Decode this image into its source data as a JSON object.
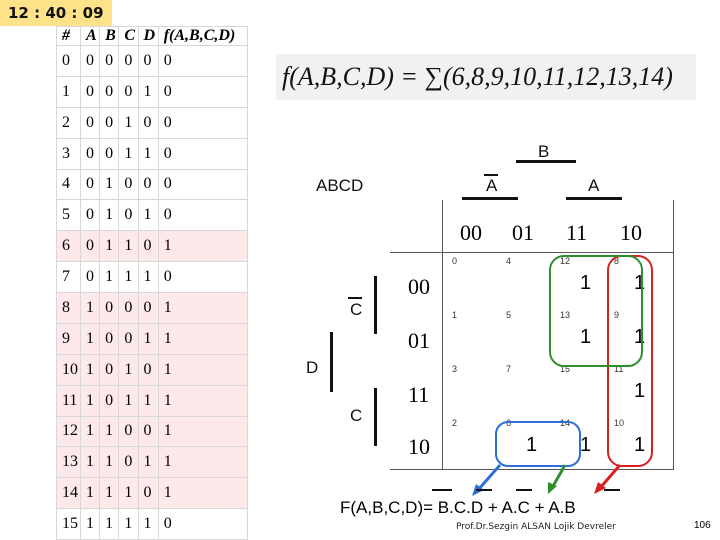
{
  "timer": "12 : 40 : 09",
  "truth_table": {
    "headers": [
      "#",
      "A",
      "B",
      "C",
      "D",
      "f(A,B,C,D)"
    ],
    "rows": [
      [
        "0",
        "0",
        "0",
        "0",
        "0",
        "0"
      ],
      [
        "1",
        "0",
        "0",
        "0",
        "1",
        "0"
      ],
      [
        "2",
        "0",
        "0",
        "1",
        "0",
        "0"
      ],
      [
        "3",
        "0",
        "0",
        "1",
        "1",
        "0"
      ],
      [
        "4",
        "0",
        "1",
        "0",
        "0",
        "0"
      ],
      [
        "5",
        "0",
        "1",
        "0",
        "1",
        "0"
      ],
      [
        "6",
        "0",
        "1",
        "1",
        "0",
        "1"
      ],
      [
        "7",
        "0",
        "1",
        "1",
        "1",
        "0"
      ],
      [
        "8",
        "1",
        "0",
        "0",
        "0",
        "1"
      ],
      [
        "9",
        "1",
        "0",
        "0",
        "1",
        "1"
      ],
      [
        "10",
        "1",
        "0",
        "1",
        "0",
        "1"
      ],
      [
        "11",
        "1",
        "0",
        "1",
        "1",
        "1"
      ],
      [
        "12",
        "1",
        "1",
        "0",
        "0",
        "1"
      ],
      [
        "13",
        "1",
        "1",
        "0",
        "1",
        "1"
      ],
      [
        "14",
        "1",
        "1",
        "1",
        "0",
        "1"
      ],
      [
        "15",
        "1",
        "1",
        "1",
        "1",
        "0"
      ]
    ]
  },
  "formula": "f(A,B,C,D) = ∑(6,8,9,10,11,12,13,14)",
  "kmap": {
    "corner_label": "ABCD",
    "top_labels": [
      "B",
      "A",
      "A"
    ],
    "col_headers": [
      "00",
      "01",
      "11",
      "10"
    ],
    "row_headers": [
      "00",
      "01",
      "11",
      "10"
    ],
    "cell_numbers": [
      [
        "0",
        "4",
        "12",
        "8"
      ],
      [
        "1",
        "5",
        "13",
        "9"
      ],
      [
        "3",
        "7",
        "15",
        "11"
      ],
      [
        "2",
        "6",
        "14",
        "10"
      ]
    ],
    "ones": [
      [
        "",
        "",
        "1",
        "1"
      ],
      [
        "",
        "",
        "1",
        "1"
      ],
      [
        "",
        "",
        "",
        "1"
      ],
      [
        "",
        "1",
        "1",
        "1"
      ]
    ],
    "side_labels": [
      "C",
      "D",
      "C"
    ]
  },
  "result": "F(A,B,C,D)= B.C.D + A.C + A.B",
  "footer": "Prof.Dr.Sezgin ALSAN  Lojik Devreler",
  "page_number": "106"
}
